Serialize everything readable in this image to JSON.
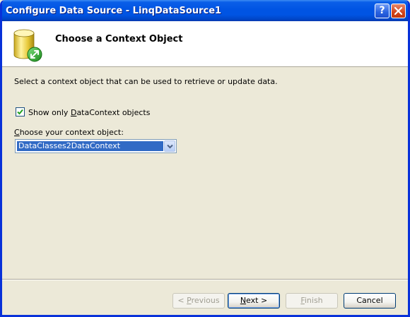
{
  "window": {
    "title": "Configure Data Source - LinqDataSource1"
  },
  "header": {
    "title": "Choose a Context Object",
    "icon": "database-icon"
  },
  "body": {
    "description": "Select a context object that can be used to retrieve or update data.",
    "show_only_checkbox": {
      "label_pre": "Show only ",
      "label_ul": "D",
      "label_post": "ataContext objects",
      "checked": true
    },
    "context_combo": {
      "label_ul": "C",
      "label_post": "hoose your context object:",
      "selected": "DataClasses2DataContext"
    }
  },
  "buttons": {
    "previous": {
      "pre": "< ",
      "ul": "P",
      "post": "revious",
      "enabled": false
    },
    "next": {
      "ul": "N",
      "post": "ext >",
      "enabled": true
    },
    "finish": {
      "ul": "F",
      "post": "inish",
      "enabled": false
    },
    "cancel": {
      "label": "Cancel",
      "enabled": true
    }
  },
  "colors": {
    "titlebar": "#0054e3",
    "selection": "#316ac5",
    "dialog_bg": "#ece9d8"
  }
}
